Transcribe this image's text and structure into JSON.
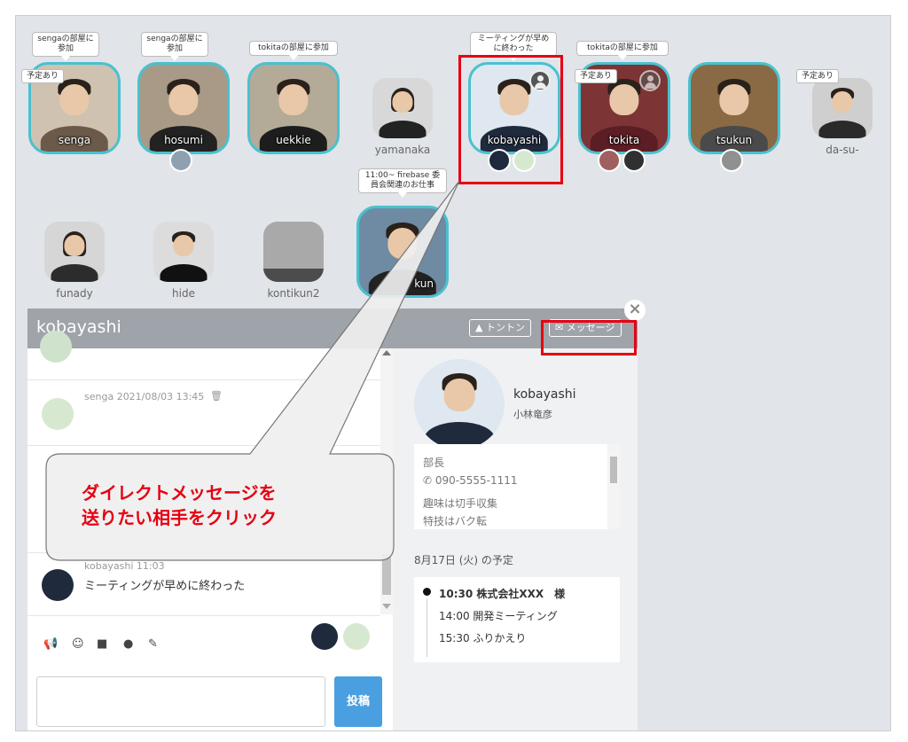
{
  "members_row1": [
    {
      "name": "senga",
      "bubble": "sengaの部屋に参加",
      "badge": "予定あり"
    },
    {
      "name": "hosumi",
      "bubble": "sengaの部屋に参加"
    },
    {
      "name": "uekkie",
      "bubble": "tokitaの部屋に参加"
    },
    {
      "name": "yamanaka"
    },
    {
      "name": "kobayashi",
      "bubble": "ミーティングが早めに終わった"
    },
    {
      "name": "tokita",
      "bubble": "tokitaの部屋に参加",
      "badge": "予定あり"
    },
    {
      "name": "tsukun"
    },
    {
      "name": "da-su-",
      "badge": "予定あり"
    }
  ],
  "members_row2": [
    {
      "name": "funady"
    },
    {
      "name": "hide"
    },
    {
      "name": "kontikun2"
    },
    {
      "name": "kun",
      "bubble": "11:00~ firebase 委員会関連のお仕事"
    }
  ],
  "panel": {
    "title": "kobayashi",
    "knock_label": "トントン",
    "message_label": "メッセージ"
  },
  "chat": {
    "messages": [
      {
        "meta": "senga  2021/08/03 13:45",
        "text": ""
      },
      {
        "meta": "kobayashi  11:03",
        "text": "ミーティングが早めに終わった"
      }
    ],
    "post_label": "投稿"
  },
  "profile": {
    "name": "kobayashi",
    "name_kanji": "小林竜彦",
    "title": "部長",
    "phone": "090-5555-1111",
    "hobby": "趣味は切手収集",
    "skill": "特技はバク転",
    "schedule_title": "8月17日 (火) の予定",
    "schedule": [
      {
        "time": "10:30",
        "title": "株式会社XXX　様"
      },
      {
        "time": "14:00",
        "title": "開発ミーティング"
      },
      {
        "time": "15:30",
        "title": "ふりかえり"
      }
    ]
  },
  "callout": {
    "line1": "ダイレクトメッセージを",
    "line2": "送りたい相手をクリック"
  },
  "colors": {
    "accent_border": "#49c1cf",
    "highlight": "#e60012",
    "header": "#9fa3aa",
    "post_button": "#4a9fe0"
  }
}
